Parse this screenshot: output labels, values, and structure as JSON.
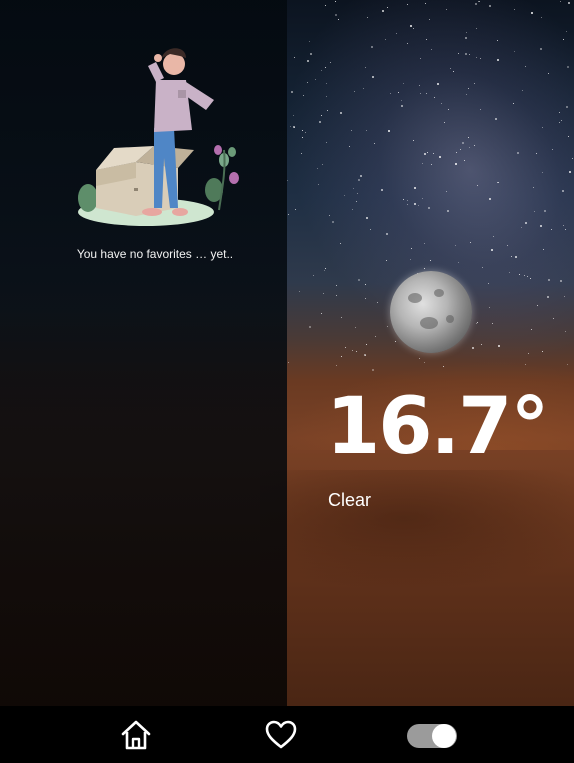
{
  "favorites": {
    "empty_message": "You have no favorites … yet.."
  },
  "weather": {
    "temperature": "16.7°",
    "condition": "Clear",
    "icon": "moon-icon"
  },
  "nav": {
    "items": [
      {
        "name": "home",
        "icon": "home-icon"
      },
      {
        "name": "favorites",
        "icon": "heart-icon"
      },
      {
        "name": "theme-toggle",
        "icon": "toggle-switch",
        "checked": true
      }
    ]
  },
  "colors": {
    "panel": "#05090e",
    "text": "#ffffff",
    "toggle_track": "#9b9b9b",
    "nav_bg": "#000000"
  }
}
